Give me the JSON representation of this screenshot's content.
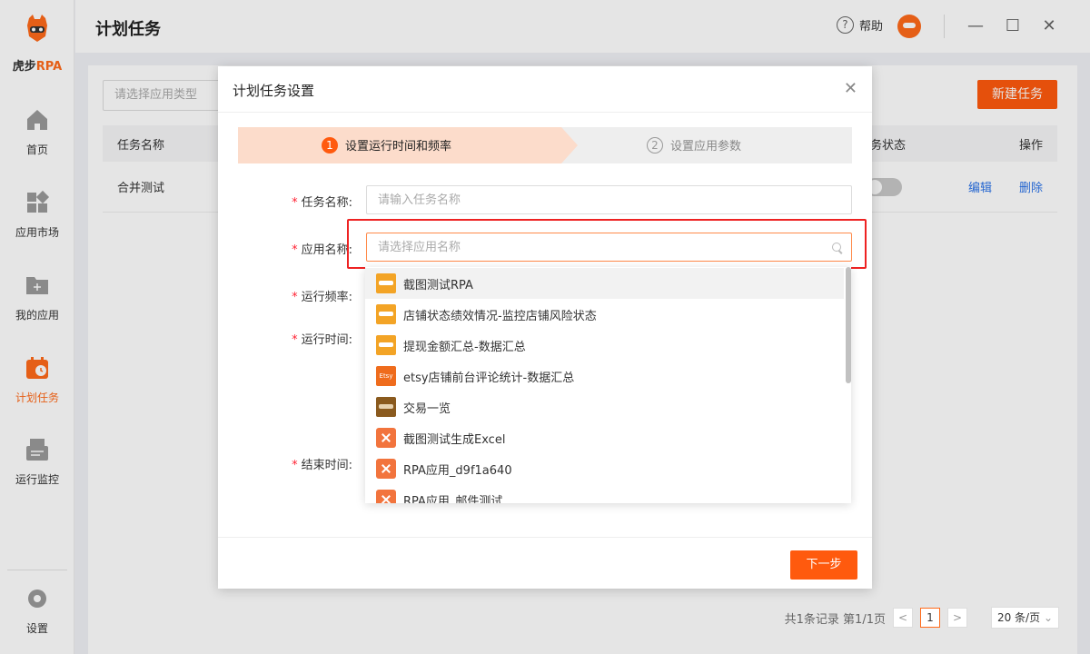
{
  "brand": {
    "logo_text_prefix": "虎步",
    "logo_text_suffix": "RPA"
  },
  "sidebar": {
    "items": [
      {
        "label": "首页",
        "icon": "home-icon"
      },
      {
        "label": "应用市场",
        "icon": "app-market-icon"
      },
      {
        "label": "我的应用",
        "icon": "folder-icon"
      },
      {
        "label": "计划任务",
        "icon": "calendar-clock-icon",
        "active": true
      },
      {
        "label": "运行监控",
        "icon": "monitor-icon"
      }
    ],
    "settings_label": "设置"
  },
  "header": {
    "title": "计划任务",
    "help_label": "帮助"
  },
  "background_page": {
    "app_type_placeholder": "请选择应用类型",
    "new_task_button": "新建任务",
    "columns": {
      "task_name": "任务名称",
      "task_status": "任务状态",
      "actions": "操作"
    },
    "row": {
      "task_name": "合并测试",
      "edit": "编辑",
      "delete": "删除"
    },
    "pagination": {
      "summary": "共1条记录 第1/1页",
      "current_page": "1",
      "page_size": "20 条/页"
    }
  },
  "dialog": {
    "title": "计划任务设置",
    "steps": [
      {
        "num": "1",
        "label": "设置运行时间和频率"
      },
      {
        "num": "2",
        "label": "设置应用参数"
      }
    ],
    "fields": {
      "task_name_label": "任务名称:",
      "task_name_placeholder": "请输入任务名称",
      "app_name_label": "应用名称:",
      "app_name_placeholder": "请选择应用名称",
      "frequency_label": "运行频率:",
      "run_time_label": "运行时间:",
      "end_time_label": "结束时间:"
    },
    "next_button": "下一步",
    "app_options": [
      {
        "label": "截图测试RPA",
        "icon": "amazon-icon"
      },
      {
        "label": "店铺状态绩效情况-监控店铺风险状态",
        "icon": "amazon-icon"
      },
      {
        "label": "提现金额汇总-数据汇总",
        "icon": "amazon-icon"
      },
      {
        "label": "etsy店铺前台评论统计-数据汇总",
        "icon": "etsy-icon"
      },
      {
        "label": "交易一览",
        "icon": "trade-icon"
      },
      {
        "label": "截图测试生成Excel",
        "icon": "rpa-app-icon"
      },
      {
        "label": "RPA应用_d9f1a640",
        "icon": "rpa-app-icon"
      },
      {
        "label": "RPA应用_邮件测试",
        "icon": "rpa-app-icon"
      }
    ]
  },
  "colors": {
    "accent": "#ff5a0e",
    "highlight_frame": "#e22222",
    "link": "#2a72e8"
  }
}
